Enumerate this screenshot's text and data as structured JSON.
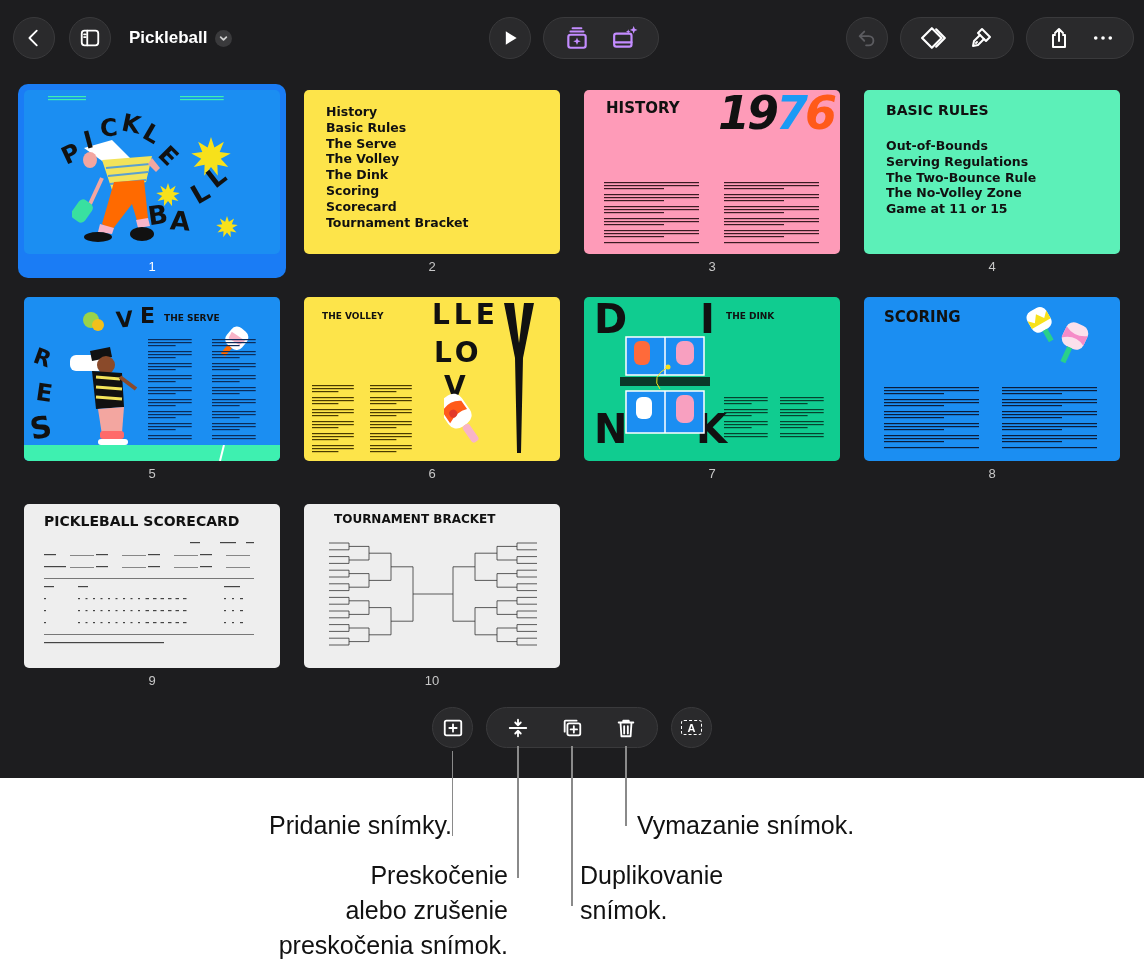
{
  "toolbar": {
    "title": "Pickleball",
    "undo_disabled": true
  },
  "slides": [
    {
      "number": "1",
      "selected": true,
      "kind": "cover",
      "color": "#1b8ef2",
      "letters": [
        "PICKLE",
        "BALL"
      ]
    },
    {
      "number": "2",
      "selected": false,
      "kind": "list",
      "color": "#fde44a",
      "items": [
        "History",
        "Basic Rules",
        "The Serve",
        "The Volley",
        "The Dink",
        "Scoring",
        "Scorecard",
        "Tournament Bracket"
      ]
    },
    {
      "number": "3",
      "selected": false,
      "kind": "history",
      "color": "#fe9bb8",
      "title": "HISTORY",
      "year": "1976"
    },
    {
      "number": "4",
      "selected": false,
      "kind": "rules",
      "color": "#5cf0b8",
      "title": "BASIC RULES",
      "items": [
        "Out-of-Bounds",
        "Serving Regulations",
        "The Two-Bounce Rule",
        "The No-Volley Zone",
        "Game at 11 or 15"
      ]
    },
    {
      "number": "5",
      "selected": false,
      "kind": "serve",
      "color": "#1b8ef2",
      "title": "THE SERVE",
      "letters": [
        "SERVE"
      ]
    },
    {
      "number": "6",
      "selected": false,
      "kind": "volley",
      "color": "#fde44a",
      "title": "THE VOLLEY",
      "letters": [
        "LLE",
        "LO",
        "V"
      ]
    },
    {
      "number": "7",
      "selected": false,
      "kind": "dink",
      "color": "#10cc90",
      "title": "THE DINK",
      "letters": [
        "D",
        "I",
        "N",
        "K"
      ]
    },
    {
      "number": "8",
      "selected": false,
      "kind": "scoring",
      "color": "#1b8ef2",
      "title": "SCORING"
    },
    {
      "number": "9",
      "selected": false,
      "kind": "scorecard",
      "color": "#eeeeee",
      "title": "PICKLEBALL SCORECARD"
    },
    {
      "number": "10",
      "selected": false,
      "kind": "bracket",
      "color": "#eeeeee",
      "title": "TOURNAMENT BRACKET"
    }
  ],
  "bottom_toolbar": {
    "text_button_glyph": "A"
  },
  "callouts": [
    {
      "text": "Pridanie snímky."
    },
    {
      "text": "Vymazanie snímok."
    },
    {
      "text": "Preskočenie\nalebo zrušenie\npreskočenia snímok."
    },
    {
      "text": "Duplikovanie\nsnímok."
    }
  ]
}
